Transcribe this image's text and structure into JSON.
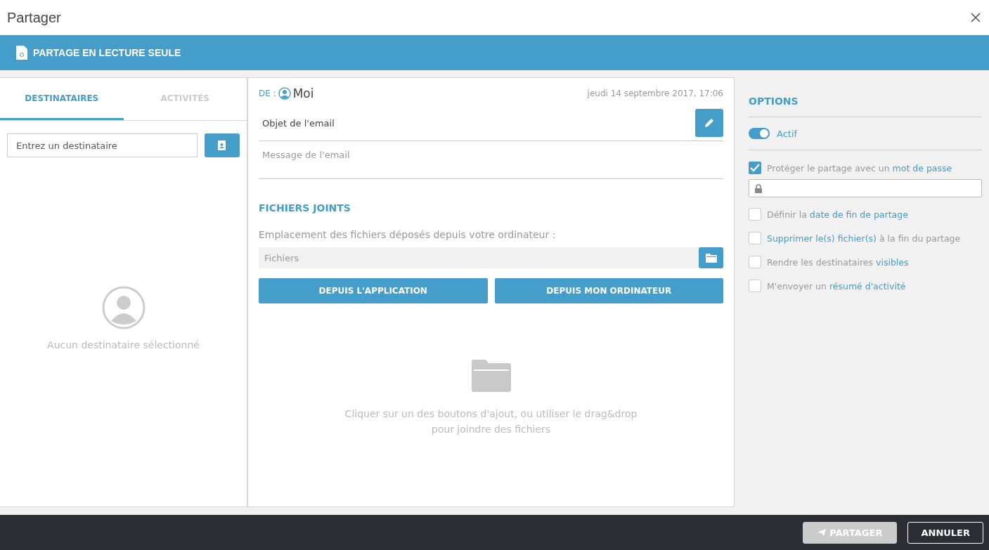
{
  "window": {
    "title": "Partager"
  },
  "banner": {
    "title": "PARTAGE EN LECTURE SEULE"
  },
  "tabs": [
    {
      "label": "DESTINATAIRES",
      "selected": true
    },
    {
      "label": "ACTIVITÉS",
      "selected": false
    }
  ],
  "recipient_field": {
    "placeholder": "Entrez un destinataire"
  },
  "recipients_empty": "Aucun destinataire sélectionné",
  "message": {
    "from_label": "DE :",
    "from": "Moi",
    "date": "jeudi 14 septembre 2017, 17:06",
    "subject": "Objet de l'email",
    "body_placeholder": "Message de l'email"
  },
  "attachments": {
    "title": "FICHIERS JOINTS",
    "location_label": "Emplacement des fichiers déposés depuis votre ordinateur :",
    "folder_placeholder": "Fichiers",
    "buttons": [
      "DEPUIS L'APPLICATION",
      "DEPUIS MON ORDINATEUR"
    ],
    "empty": [
      "Cliquer sur un des boutons d'ajout, ou utiliser le drag&drop",
      "pour joindre des fichiers"
    ]
  },
  "options": {
    "title": "OPTIONS",
    "active": {
      "label": "Actif",
      "on": true
    },
    "items": [
      {
        "checked": true,
        "parts": [
          {
            "text": "Protéger le partage avec un ",
            "link": false
          },
          {
            "text": "mot de passe",
            "link": true
          }
        ],
        "password_field": true
      },
      {
        "checked": false,
        "parts": [
          {
            "text": "Définir la ",
            "link": false
          },
          {
            "text": "date de fin de partage",
            "link": true
          }
        ]
      },
      {
        "checked": false,
        "parts": [
          {
            "text": "Supprimer le(s) fichier(s)",
            "link": true
          },
          {
            "text": " à la fin du partage",
            "link": false
          }
        ]
      },
      {
        "checked": false,
        "parts": [
          {
            "text": "Rendre les destinataires ",
            "link": false
          },
          {
            "text": "visibles",
            "link": true
          }
        ]
      },
      {
        "checked": false,
        "parts": [
          {
            "text": "M'envoyer un ",
            "link": false
          },
          {
            "text": "résumé d'activité",
            "link": true
          }
        ]
      }
    ]
  },
  "footer": {
    "buttons": [
      {
        "label": "PARTAGER",
        "disabled": true
      },
      {
        "label": "ANNULER",
        "disabled": false
      }
    ]
  }
}
